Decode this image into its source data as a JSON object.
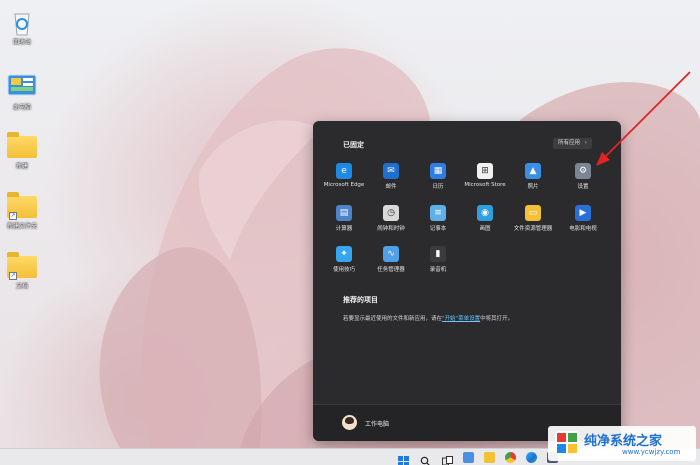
{
  "desktop": {
    "icons": [
      {
        "label": "回收站",
        "icon": "recycle-bin-icon"
      },
      {
        "label": "此电脑",
        "icon": "control-panel-icon"
      },
      {
        "label": "新建",
        "icon": "folder-icon"
      },
      {
        "label": "新建文件夹",
        "icon": "folder-shortcut-icon"
      },
      {
        "label": "文档",
        "icon": "folder-shortcut-icon"
      }
    ]
  },
  "start_menu": {
    "pinned_title": "已固定",
    "all_apps_label": "所有应用",
    "all_apps_chevron": "›",
    "apps": [
      {
        "label": "Microsoft Edge",
        "icon": "edge-icon",
        "color": "#1e88e5",
        "glyph": "e"
      },
      {
        "label": "邮件",
        "icon": "mail-icon",
        "color": "#1f6fd1",
        "glyph": "✉"
      },
      {
        "label": "日历",
        "icon": "calendar-icon",
        "color": "#2f7de1",
        "glyph": "▦"
      },
      {
        "label": "Microsoft Store",
        "icon": "store-icon",
        "color": "#f0f0f0",
        "glyph": "⊞"
      },
      {
        "label": "照片",
        "icon": "photos-icon",
        "color": "#3a8ee6",
        "glyph": "▲"
      },
      {
        "label": "设置",
        "icon": "settings-gear-icon",
        "color": "#7b8593",
        "glyph": "⚙"
      },
      {
        "label": "计算器",
        "icon": "calculator-icon",
        "color": "#4c84c9",
        "glyph": "▤"
      },
      {
        "label": "闹钟和时钟",
        "icon": "clock-icon",
        "color": "#d9d9d9",
        "glyph": "◷"
      },
      {
        "label": "记事本",
        "icon": "notepad-icon",
        "color": "#5db0e8",
        "glyph": "≡"
      },
      {
        "label": "画图",
        "icon": "paint-icon",
        "color": "#2f9fe0",
        "glyph": "◉"
      },
      {
        "label": "文件资源管理器",
        "icon": "file-explorer-icon",
        "color": "#f3c038",
        "glyph": "▭"
      },
      {
        "label": "电影和电视",
        "icon": "movies-tv-icon",
        "color": "#2a6fd6",
        "glyph": "▶"
      },
      {
        "label": "使用技巧",
        "icon": "tips-icon",
        "color": "#35a6ef",
        "glyph": "✦"
      },
      {
        "label": "任务管理器",
        "icon": "task-manager-icon",
        "color": "#4ea0e8",
        "glyph": "∿"
      },
      {
        "label": "录音机",
        "icon": "voice-recorder-icon",
        "color": "#3b3b3e",
        "glyph": "▮"
      }
    ],
    "recommended_title": "推荐的项目",
    "recommended_text": "若要显示最近使用的文件和新应用，请在",
    "recommended_link": "\"开始\"菜单设置",
    "recommended_suffix": "中将其打开。",
    "user_name": "工作电脑"
  },
  "taskbar": {
    "icons": [
      "start-icon",
      "search-icon",
      "task-view-icon",
      "widgets-icon",
      "file-explorer-icon",
      "chrome-icon",
      "edge-icon",
      "store-icon"
    ]
  },
  "watermark": {
    "title": "纯净系统之家",
    "url": "www.ycwjzy.com"
  },
  "colors": {
    "annotation_arrow": "#e02424",
    "start_bg": "#2b2a2d",
    "link": "#6cc6ff"
  }
}
